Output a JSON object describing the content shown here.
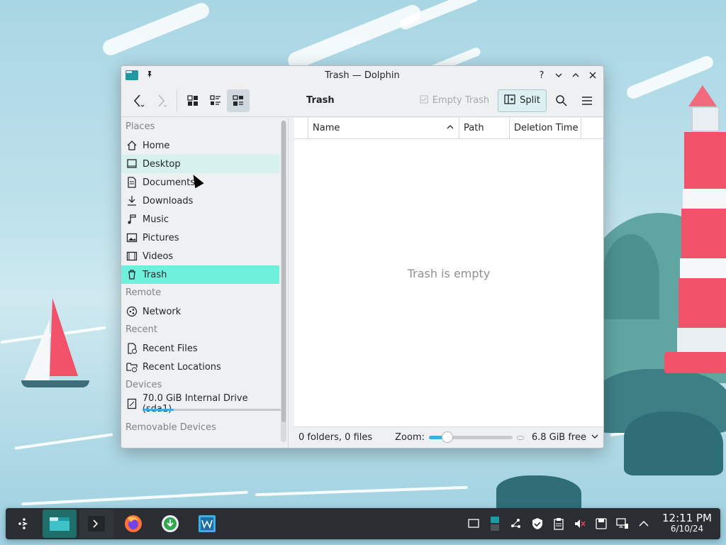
{
  "window": {
    "title": "Trash — Dolphin",
    "help_label": "?",
    "location_title": "Trash"
  },
  "toolbar": {
    "empty_trash_label": "Empty Trash",
    "split_label": "Split"
  },
  "places": {
    "sections": {
      "places": "Places",
      "remote": "Remote",
      "recent": "Recent",
      "devices": "Devices",
      "removable": "Removable Devices"
    },
    "items": [
      {
        "label": "Home",
        "icon": "home-icon"
      },
      {
        "label": "Desktop",
        "icon": "desktop-icon"
      },
      {
        "label": "Documents",
        "icon": "documents-icon"
      },
      {
        "label": "Downloads",
        "icon": "downloads-icon"
      },
      {
        "label": "Music",
        "icon": "music-icon"
      },
      {
        "label": "Pictures",
        "icon": "pictures-icon"
      },
      {
        "label": "Videos",
        "icon": "videos-icon"
      },
      {
        "label": "Trash",
        "icon": "trash-icon"
      }
    ],
    "remote": [
      {
        "label": "Network",
        "icon": "network-icon"
      }
    ],
    "recent": [
      {
        "label": "Recent Files",
        "icon": "recent-files-icon"
      },
      {
        "label": "Recent Locations",
        "icon": "recent-locations-icon"
      }
    ],
    "devices": [
      {
        "label": "70.0 GiB Internal Drive (sda1)",
        "icon": "drive-icon",
        "usage_fraction": 0.22
      }
    ]
  },
  "columns": {
    "name": "Name",
    "path": "Path",
    "deletion_time": "Deletion Time"
  },
  "main": {
    "empty_message": "Trash is empty"
  },
  "status": {
    "counts": "0 folders, 0 files",
    "zoom_label": "Zoom:",
    "zoom_fraction": 0.15,
    "free_space": "6.8 GiB free"
  },
  "taskbar": {
    "clock_time": "12:11 PM",
    "clock_date": "6/10/24"
  },
  "colors": {
    "accent": "#3daee9",
    "selection": "#6ef0dc",
    "hover": "#d7f1ee",
    "taskbar": "#2a2e32"
  }
}
